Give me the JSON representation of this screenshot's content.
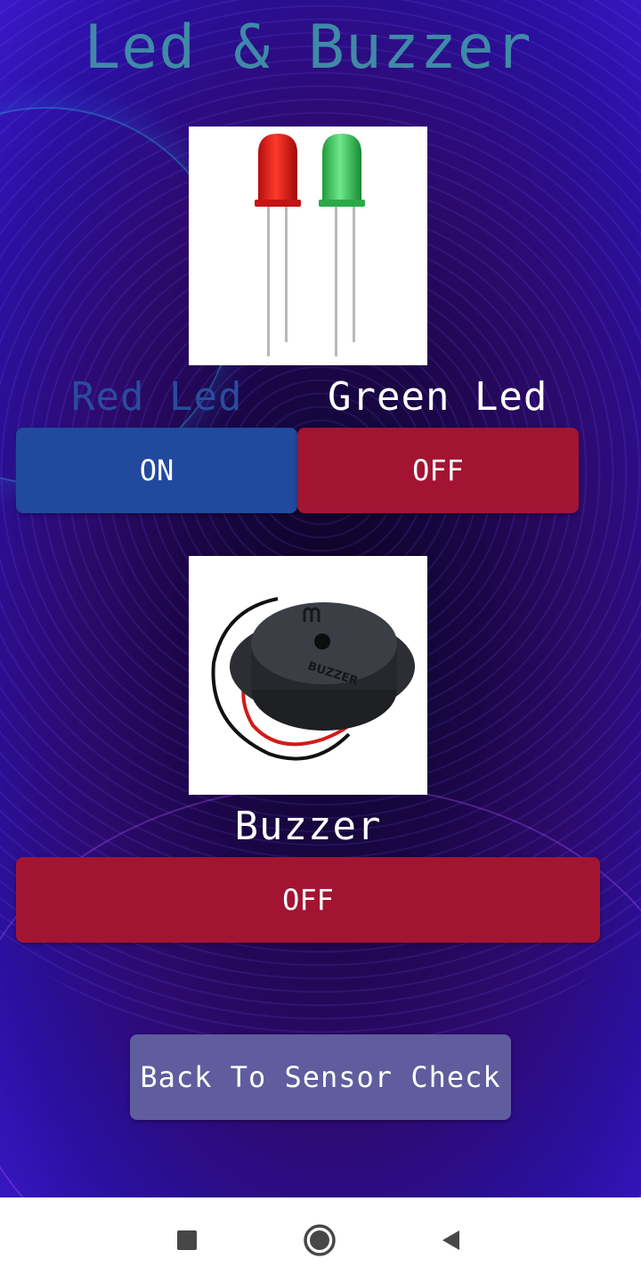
{
  "title": "Led & Buzzer",
  "led_section": {
    "image_icon": "led-pair-image",
    "red_led": {
      "label": "Red Led",
      "button_label": "ON",
      "color": "#214a9e"
    },
    "green_led": {
      "label": "Green Led",
      "button_label": "OFF",
      "color": "#a31433"
    }
  },
  "buzzer_section": {
    "image_icon": "buzzer-image",
    "image_text": "BUZZER",
    "label": "Buzzer",
    "button_label": "OFF",
    "color": "#a31433"
  },
  "back_button": {
    "label": "Back To Sensor Check",
    "color": "#5f5d9e"
  },
  "nav_bar": {
    "recents_icon": "square-icon",
    "home_icon": "circle-icon",
    "back_icon": "triangle-back-icon"
  }
}
